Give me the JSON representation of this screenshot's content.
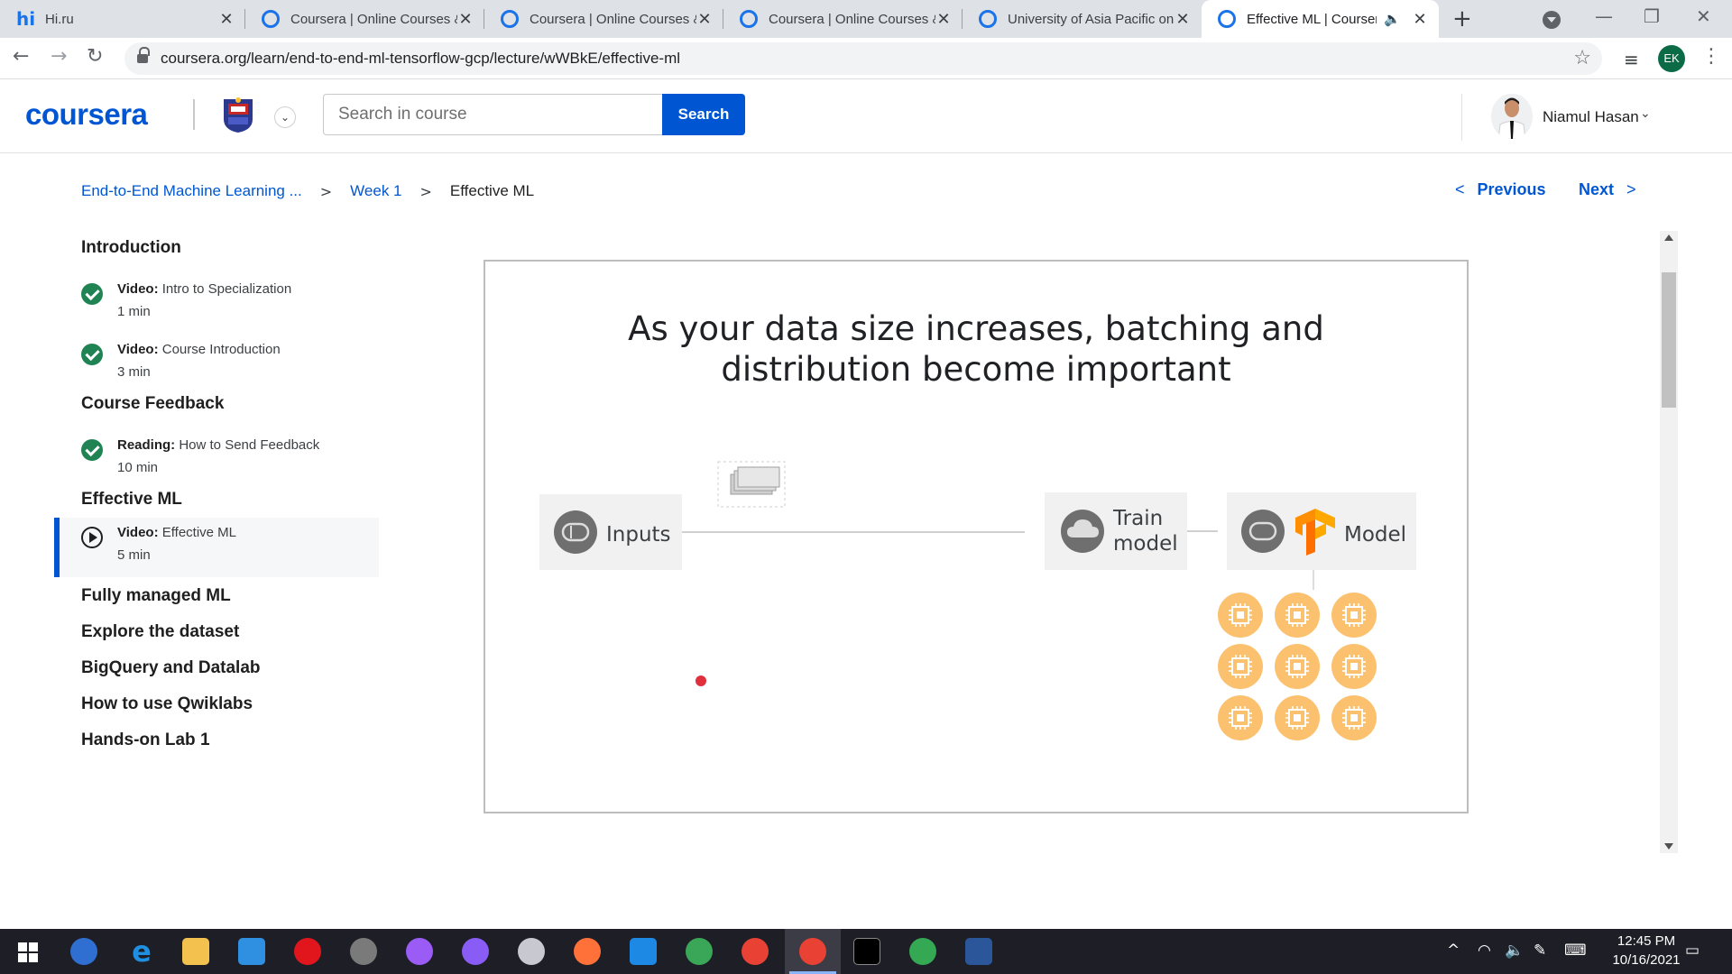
{
  "browser": {
    "tabs": [
      {
        "title": "Hi.ru",
        "icon": "hi-icon",
        "active": false
      },
      {
        "title": "Coursera | Online Courses &",
        "icon": "coursera-favicon-icon",
        "active": false
      },
      {
        "title": "Coursera | Online Courses &",
        "icon": "coursera-favicon-icon",
        "active": false
      },
      {
        "title": "Coursera | Online Courses &",
        "icon": "coursera-favicon-icon",
        "active": false
      },
      {
        "title": "University of Asia Pacific on",
        "icon": "coursera-favicon-icon",
        "active": false
      },
      {
        "title": "Effective ML | Coursera",
        "icon": "coursera-favicon-icon",
        "active": true
      }
    ],
    "url": "coursera.org/learn/end-to-end-ml-tensorflow-gcp/lecture/wWBkE/effective-ml",
    "profile_initials": "EK"
  },
  "header": {
    "logo": "coursera",
    "search_placeholder": "Search in course",
    "search_button": "Search",
    "user_name": "Niamul Hasan"
  },
  "breadcrumb": {
    "course": "End-to-End Machine Learning ...",
    "week": "Week 1",
    "current": "Effective ML"
  },
  "pager": {
    "previous": "Previous",
    "next": "Next"
  },
  "sidebar": {
    "introduction": {
      "title": "Introduction",
      "items": [
        {
          "type": "Video:",
          "name": "Intro to Specialization",
          "duration": "1 min",
          "status": "completed"
        },
        {
          "type": "Video:",
          "name": "Course Introduction",
          "duration": "3 min",
          "status": "completed"
        }
      ]
    },
    "feedback": {
      "title": "Course Feedback",
      "items": [
        {
          "type": "Reading:",
          "name": "How to Send Feedback",
          "duration": "10 min",
          "status": "completed"
        }
      ]
    },
    "effective": {
      "title": "Effective ML",
      "items": [
        {
          "type": "Video:",
          "name": "Effective ML",
          "duration": "5 min",
          "status": "current"
        }
      ]
    },
    "other_sections": [
      "Fully managed ML",
      "Explore the dataset",
      "BigQuery and Datalab",
      "How to use Qwiklabs",
      "Hands-on Lab 1"
    ]
  },
  "slide": {
    "title_line1": "As your data size increases, batching and",
    "title_line2": "distribution become important",
    "inputs_label": "Inputs",
    "train_label_1": "Train",
    "train_label_2": "model",
    "model_label": "Model",
    "chip_count": 9
  },
  "taskbar": {
    "time": "12:45 PM",
    "date": "10/16/2021"
  },
  "colors": {
    "brand": "#0056d2",
    "completed": "#1f8354",
    "chip": "#fbc16f",
    "tensorflow": "#ff8f00"
  }
}
